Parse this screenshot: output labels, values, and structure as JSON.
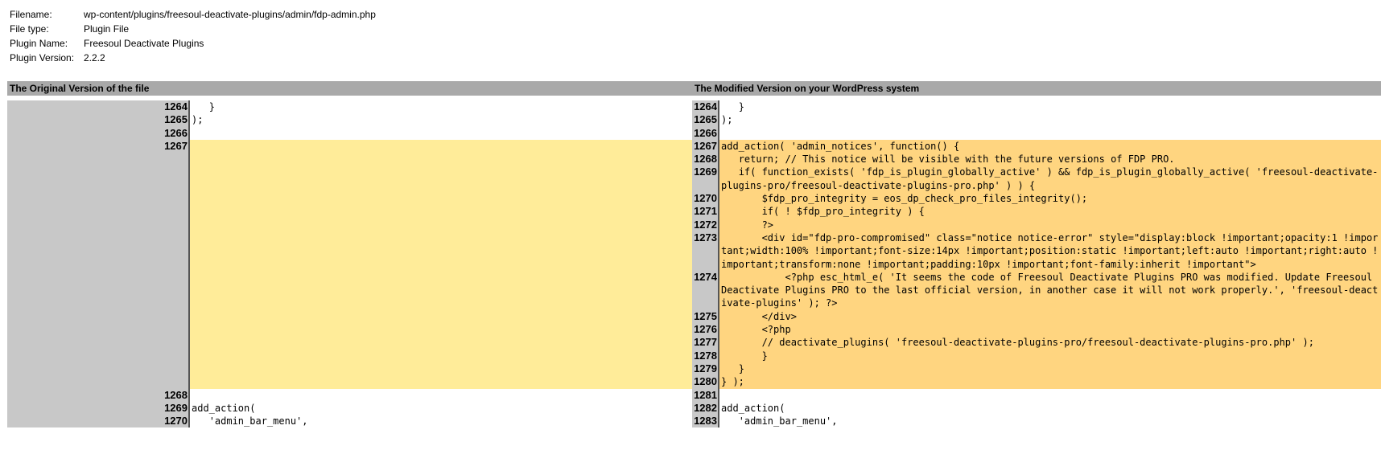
{
  "meta": {
    "filename_label": "Filename:",
    "filename_value": "wp-content/plugins/freesoul-deactivate-plugins/admin/fdp-admin.php",
    "filetype_label": "File type:",
    "filetype_value": "Plugin File",
    "pluginname_label": "Plugin Name:",
    "pluginname_value": "Freesoul Deactivate Plugins",
    "pluginversion_label": "Plugin Version:",
    "pluginversion_value": "2.2.2"
  },
  "header": {
    "left": "The Original Version of the file",
    "right": "The Modified Version on your WordPress system"
  },
  "colors": {
    "header_bg": "#a9a9a9",
    "num_bg": "#c8c8c8",
    "removed_bg": "#ffec99",
    "added_bg": "#ffd580"
  },
  "left_lines": [
    {
      "num": "1264",
      "code": "   }",
      "kind": "ctx"
    },
    {
      "num": "1265",
      "code": ");",
      "kind": "ctx"
    },
    {
      "num": "1266",
      "code": "",
      "kind": "ctx"
    },
    {
      "num": "1267",
      "code": "",
      "kind": "rem",
      "span": 19
    },
    {
      "num": "1268",
      "code": "",
      "kind": "ctx"
    },
    {
      "num": "1269",
      "code": "add_action(",
      "kind": "ctx"
    },
    {
      "num": "1270",
      "code": "   'admin_bar_menu',",
      "kind": "ctx"
    }
  ],
  "right_lines": [
    {
      "num": "1264",
      "code": "   }",
      "kind": "ctx"
    },
    {
      "num": "1265",
      "code": ");",
      "kind": "ctx"
    },
    {
      "num": "1266",
      "code": "",
      "kind": "ctx"
    },
    {
      "num": "1267",
      "code": "add_action( 'admin_notices', function() {",
      "kind": "add"
    },
    {
      "num": "1268",
      "code": "   return; // This notice will be visible with the future versions of FDP PRO.",
      "kind": "add"
    },
    {
      "num": "1269",
      "code": "   if( function_exists( 'fdp_is_plugin_globally_active' ) && fdp_is_plugin_globally_active( 'freesoul-deactivate-plugins-pro/freesoul-deactivate-plugins-pro.php' ) ) {",
      "kind": "add"
    },
    {
      "num": "1270",
      "code": "       $fdp_pro_integrity = eos_dp_check_pro_files_integrity();",
      "kind": "add"
    },
    {
      "num": "1271",
      "code": "       if( ! $fdp_pro_integrity ) {",
      "kind": "add"
    },
    {
      "num": "1272",
      "code": "       ?>",
      "kind": "add"
    },
    {
      "num": "1273",
      "code": "       <div id=\"fdp-pro-compromised\" class=\"notice notice-error\" style=\"display:block !important;opacity:1 !important;width:100% !important;font-size:14px !important;position:static !important;left:auto !important;right:auto !important;transform:none !important;padding:10px !important;font-family:inherit !important\">",
      "kind": "add"
    },
    {
      "num": "1274",
      "code": "           <?php esc_html_e( 'It seems the code of Freesoul Deactivate Plugins PRO was modified. Update Freesoul Deactivate Plugins PRO to the last official version, in another case it will not work properly.', 'freesoul-deactivate-plugins' ); ?>",
      "kind": "add"
    },
    {
      "num": "1275",
      "code": "       </div>",
      "kind": "add"
    },
    {
      "num": "1276",
      "code": "       <?php",
      "kind": "add"
    },
    {
      "num": "1277",
      "code": "       // deactivate_plugins( 'freesoul-deactivate-plugins-pro/freesoul-deactivate-plugins-pro.php' );",
      "kind": "add"
    },
    {
      "num": "1278",
      "code": "       }",
      "kind": "add"
    },
    {
      "num": "1279",
      "code": "   }",
      "kind": "add"
    },
    {
      "num": "1280",
      "code": "} );",
      "kind": "add"
    },
    {
      "num": "1281",
      "code": "",
      "kind": "ctx"
    },
    {
      "num": "1282",
      "code": "add_action(",
      "kind": "ctx"
    },
    {
      "num": "1283",
      "code": "   'admin_bar_menu',",
      "kind": "ctx"
    }
  ]
}
